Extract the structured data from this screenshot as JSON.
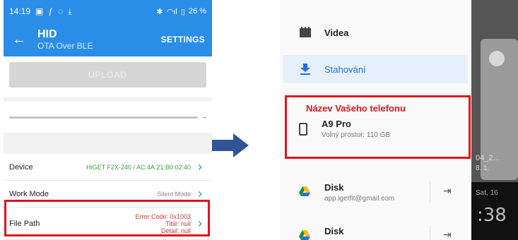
{
  "left": {
    "status": {
      "time": "14:19",
      "battery": "26 %"
    },
    "appbar": {
      "title": "HID",
      "subtitle": "OTA Over BLE",
      "settings": "SETTINGS"
    },
    "upload": {
      "label": "UPLOAD"
    },
    "progress": {
      "text": "–"
    },
    "rows": {
      "device": {
        "label": "Device",
        "value": "HiGET F2X-240 / AC:4A:21:B0:02:40"
      },
      "workmode": {
        "label": "Work Mode",
        "value": "Silent Mode"
      },
      "filepath": {
        "label": "File Path",
        "error": "Error Code: 0x1003",
        "title": "Title: null",
        "detail": "Detail: null"
      }
    }
  },
  "right": {
    "drawer": {
      "videa": "Videa",
      "downloads": "Stahování",
      "phone_title": "Název Vašeho telefonu",
      "phone_name": "A9 Pro",
      "phone_storage": "Volný prostor: 110 GB",
      "disk1_name": "Disk",
      "disk1_account": "app.igetfit@gmail.com",
      "disk2_name": "Disk"
    },
    "overlay": {
      "file1": "04_2...",
      "file2": "8. 1.",
      "day": "Sat, 16",
      "time": ":38"
    }
  },
  "colors": {
    "accent": "#2a8ee8",
    "highlight": "#e0141e",
    "green": "#3b9b3b"
  },
  "icons": [
    "back-arrow-icon",
    "chevron-right-icon",
    "download-icon",
    "video-icon",
    "phone-icon",
    "drive-icon",
    "eject-icon"
  ]
}
